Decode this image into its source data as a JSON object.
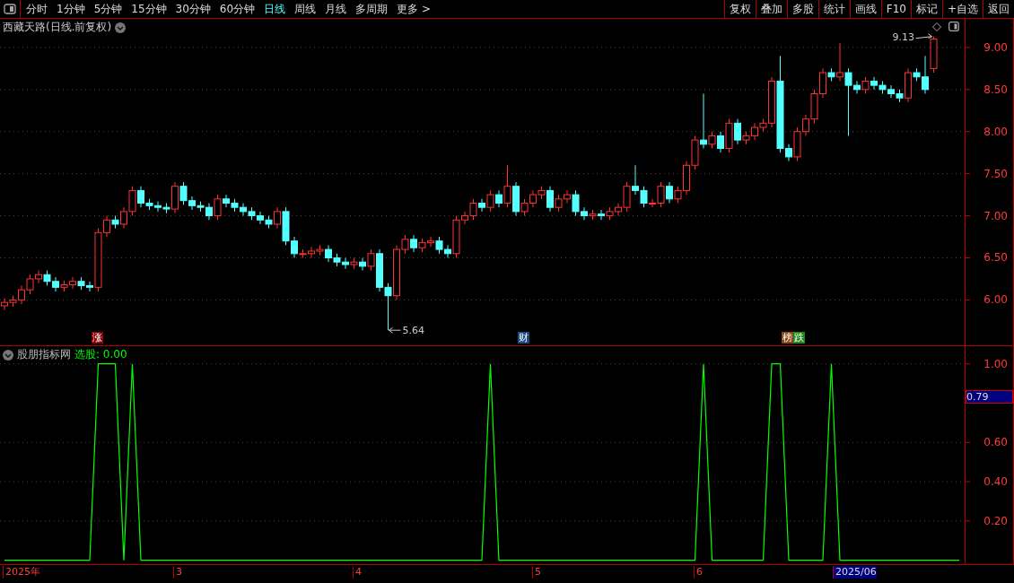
{
  "toolbar": {
    "periods": [
      {
        "label": "分时",
        "selected": false
      },
      {
        "label": "1分钟",
        "selected": false
      },
      {
        "label": "5分钟",
        "selected": false
      },
      {
        "label": "15分钟",
        "selected": false
      },
      {
        "label": "30分钟",
        "selected": false
      },
      {
        "label": "60分钟",
        "selected": false
      },
      {
        "label": "日线",
        "selected": true
      },
      {
        "label": "周线",
        "selected": false
      },
      {
        "label": "月线",
        "selected": false
      },
      {
        "label": "多周期",
        "selected": false
      },
      {
        "label": "更多 >",
        "selected": false
      }
    ],
    "buttons": [
      "复权",
      "叠加",
      "多股",
      "统计",
      "画线",
      "F10",
      "标记",
      "+自选",
      "返回"
    ]
  },
  "price_panel": {
    "title": "西藏天路(日线.前复权)",
    "high_label": "9.13",
    "low_label": "5.64",
    "chart_data": {
      "type": "candlestick",
      "grid": true,
      "ylim": [
        5.45,
        9.34
      ],
      "yticks": [
        {
          "value": 9,
          "label": "9.00"
        },
        {
          "value": 8.5,
          "label": "8.50"
        },
        {
          "value": 8,
          "label": "8.00"
        },
        {
          "value": 7.5,
          "label": "7.50"
        },
        {
          "value": 7,
          "label": "7.00"
        },
        {
          "value": 6.5,
          "label": "6.50"
        },
        {
          "value": 6,
          "label": "6.00"
        }
      ],
      "ohlc": [
        [
          5.93,
          6.02,
          5.88,
          5.97
        ],
        [
          5.97,
          6.05,
          5.92,
          6.0
        ],
        [
          6.0,
          6.17,
          5.95,
          6.12
        ],
        [
          6.12,
          6.3,
          6.07,
          6.25
        ],
        [
          6.25,
          6.35,
          6.2,
          6.3
        ],
        [
          6.3,
          6.35,
          6.17,
          6.22
        ],
        [
          6.22,
          6.27,
          6.1,
          6.15
        ],
        [
          6.15,
          6.23,
          6.1,
          6.18
        ],
        [
          6.18,
          6.27,
          6.13,
          6.22
        ],
        [
          6.22,
          6.27,
          6.12,
          6.17
        ],
        [
          6.17,
          6.22,
          6.1,
          6.15
        ],
        [
          6.15,
          6.85,
          6.1,
          6.8
        ],
        [
          6.8,
          7.0,
          6.75,
          6.95
        ],
        [
          6.95,
          7.0,
          6.85,
          6.9
        ],
        [
          6.9,
          7.1,
          6.85,
          7.05
        ],
        [
          7.05,
          7.35,
          7.0,
          7.3
        ],
        [
          7.3,
          7.35,
          7.1,
          7.15
        ],
        [
          7.15,
          7.2,
          7.07,
          7.12
        ],
        [
          7.12,
          7.17,
          7.05,
          7.1
        ],
        [
          7.1,
          7.15,
          7.03,
          7.08
        ],
        [
          7.08,
          7.4,
          7.03,
          7.35
        ],
        [
          7.35,
          7.4,
          7.13,
          7.18
        ],
        [
          7.18,
          7.23,
          7.07,
          7.12
        ],
        [
          7.12,
          7.17,
          7.05,
          7.1
        ],
        [
          7.1,
          7.15,
          6.95,
          7.0
        ],
        [
          7.0,
          7.25,
          6.95,
          7.2
        ],
        [
          7.2,
          7.25,
          7.1,
          7.15
        ],
        [
          7.15,
          7.2,
          7.05,
          7.1
        ],
        [
          7.1,
          7.15,
          7.0,
          7.05
        ],
        [
          7.05,
          7.1,
          6.95,
          7.0
        ],
        [
          7.0,
          7.05,
          6.9,
          6.95
        ],
        [
          6.95,
          7.0,
          6.85,
          6.9
        ],
        [
          6.9,
          7.1,
          6.85,
          7.05
        ],
        [
          7.05,
          7.1,
          6.65,
          6.7
        ],
        [
          6.7,
          6.75,
          6.5,
          6.55
        ],
        [
          6.55,
          6.6,
          6.5,
          6.55
        ],
        [
          6.55,
          6.63,
          6.5,
          6.58
        ],
        [
          6.58,
          6.65,
          6.53,
          6.6
        ],
        [
          6.6,
          6.65,
          6.45,
          6.5
        ],
        [
          6.5,
          6.55,
          6.4,
          6.45
        ],
        [
          6.45,
          6.5,
          6.37,
          6.42
        ],
        [
          6.42,
          6.5,
          6.37,
          6.45
        ],
        [
          6.45,
          6.5,
          6.35,
          6.4
        ],
        [
          6.4,
          6.6,
          6.35,
          6.55
        ],
        [
          6.55,
          6.6,
          6.1,
          6.15
        ],
        [
          6.15,
          6.2,
          5.64,
          6.05
        ],
        [
          6.05,
          6.65,
          6.0,
          6.6
        ],
        [
          6.6,
          6.77,
          6.55,
          6.72
        ],
        [
          6.72,
          6.77,
          6.57,
          6.62
        ],
        [
          6.62,
          6.73,
          6.57,
          6.68
        ],
        [
          6.68,
          6.75,
          6.63,
          6.7
        ],
        [
          6.7,
          6.75,
          6.55,
          6.6
        ],
        [
          6.6,
          6.65,
          6.5,
          6.55
        ],
        [
          6.55,
          7.0,
          6.5,
          6.95
        ],
        [
          6.95,
          7.05,
          6.9,
          7.0
        ],
        [
          7.0,
          7.2,
          6.95,
          7.15
        ],
        [
          7.15,
          7.2,
          7.05,
          7.1
        ],
        [
          7.1,
          7.3,
          7.05,
          7.25
        ],
        [
          7.25,
          7.3,
          7.1,
          7.15
        ],
        [
          7.15,
          7.6,
          7.1,
          7.35
        ],
        [
          7.35,
          7.4,
          7.0,
          7.05
        ],
        [
          7.05,
          7.2,
          7.0,
          7.15
        ],
        [
          7.15,
          7.3,
          7.1,
          7.25
        ],
        [
          7.25,
          7.35,
          7.2,
          7.3
        ],
        [
          7.3,
          7.35,
          7.05,
          7.1
        ],
        [
          7.1,
          7.25,
          7.05,
          7.2
        ],
        [
          7.2,
          7.3,
          7.15,
          7.25
        ],
        [
          7.25,
          7.3,
          7.0,
          7.05
        ],
        [
          7.05,
          7.1,
          6.95,
          7.0
        ],
        [
          7.0,
          7.07,
          6.95,
          7.02
        ],
        [
          7.02,
          7.07,
          6.95,
          7.0
        ],
        [
          7.0,
          7.1,
          6.95,
          7.05
        ],
        [
          7.05,
          7.15,
          7.0,
          7.1
        ],
        [
          7.1,
          7.4,
          7.05,
          7.35
        ],
        [
          7.35,
          7.6,
          7.25,
          7.3
        ],
        [
          7.3,
          7.35,
          7.1,
          7.15
        ],
        [
          7.15,
          7.2,
          7.1,
          7.15
        ],
        [
          7.15,
          7.4,
          7.1,
          7.35
        ],
        [
          7.35,
          7.4,
          7.15,
          7.2
        ],
        [
          7.2,
          7.35,
          7.15,
          7.3
        ],
        [
          7.3,
          7.65,
          7.25,
          7.6
        ],
        [
          7.6,
          7.95,
          7.55,
          7.9
        ],
        [
          7.9,
          8.45,
          7.8,
          7.85
        ],
        [
          7.85,
          8.0,
          7.8,
          7.95
        ],
        [
          7.95,
          8.0,
          7.75,
          7.8
        ],
        [
          7.8,
          8.15,
          7.75,
          8.1
        ],
        [
          8.1,
          8.15,
          7.85,
          7.9
        ],
        [
          7.9,
          8.0,
          7.85,
          7.95
        ],
        [
          7.95,
          8.1,
          7.9,
          8.05
        ],
        [
          8.05,
          8.15,
          8.0,
          8.1
        ],
        [
          8.1,
          8.65,
          8.05,
          8.6
        ],
        [
          8.6,
          8.9,
          7.75,
          7.8
        ],
        [
          7.8,
          7.85,
          7.65,
          7.7
        ],
        [
          7.7,
          8.05,
          7.65,
          8.0
        ],
        [
          8.0,
          8.2,
          7.95,
          8.15
        ],
        [
          8.15,
          8.5,
          8.1,
          8.45
        ],
        [
          8.45,
          8.75,
          8.4,
          8.7
        ],
        [
          8.7,
          8.75,
          8.6,
          8.65
        ],
        [
          8.65,
          9.05,
          8.6,
          8.7
        ],
        [
          8.7,
          8.75,
          7.95,
          8.55
        ],
        [
          8.55,
          8.6,
          8.45,
          8.5
        ],
        [
          8.5,
          8.65,
          8.45,
          8.6
        ],
        [
          8.6,
          8.65,
          8.5,
          8.55
        ],
        [
          8.55,
          8.6,
          8.45,
          8.5
        ],
        [
          8.5,
          8.55,
          8.4,
          8.45
        ],
        [
          8.45,
          8.5,
          8.35,
          8.4
        ],
        [
          8.4,
          8.75,
          8.35,
          8.7
        ],
        [
          8.7,
          8.75,
          8.6,
          8.65
        ],
        [
          8.65,
          8.9,
          8.45,
          8.5
        ],
        [
          8.75,
          9.13,
          8.7,
          9.1
        ]
      ]
    },
    "event_tags": [
      {
        "text": "涨",
        "color": "#8b0000"
      },
      {
        "text": "财",
        "color": "#1a4a80"
      },
      {
        "text": "榜",
        "color": "#8b4513"
      },
      {
        "text": "跌",
        "color": "#1a8a1a"
      }
    ]
  },
  "indicator_panel": {
    "name": "股朋指标网",
    "reading": ": 0.00",
    "cursor_value": "0.79",
    "chart_data": {
      "type": "line",
      "grid": true,
      "ylim": [
        -0.02,
        1.09
      ],
      "yticks": [
        {
          "value": 0.2,
          "label": "0.20"
        },
        {
          "value": 0.4,
          "label": "0.40"
        },
        {
          "value": 0.6,
          "label": "0.60"
        },
        {
          "value": 1,
          "label": "1.00"
        }
      ],
      "series": [
        {
          "name": "选股",
          "color": "#00ff00",
          "values": [
            0,
            0,
            0,
            0,
            0,
            0,
            0,
            0,
            0,
            0,
            0,
            1,
            1,
            1,
            0,
            1,
            0,
            0,
            0,
            0,
            0,
            0,
            0,
            0,
            0,
            0,
            0,
            0,
            0,
            0,
            0,
            0,
            0,
            0,
            0,
            0,
            0,
            0,
            0,
            0,
            0,
            0,
            0,
            0,
            0,
            0,
            0,
            0,
            0,
            0,
            0,
            0,
            0,
            0,
            0,
            0,
            0,
            1,
            0,
            0,
            0,
            0,
            0,
            0,
            0,
            0,
            0,
            0,
            0,
            0,
            0,
            0,
            0,
            0,
            0,
            0,
            0,
            0,
            0,
            0,
            0,
            0,
            1,
            0,
            0,
            0,
            0,
            0,
            0,
            0,
            1,
            1,
            0,
            0,
            0,
            0,
            0,
            1,
            0,
            0,
            0,
            0,
            0,
            0,
            0,
            0,
            0,
            0,
            0,
            0,
            0,
            0,
            0
          ]
        }
      ]
    }
  },
  "date_axis": [
    "2025年",
    "3",
    "4",
    "5",
    "6",
    "2025/06"
  ]
}
